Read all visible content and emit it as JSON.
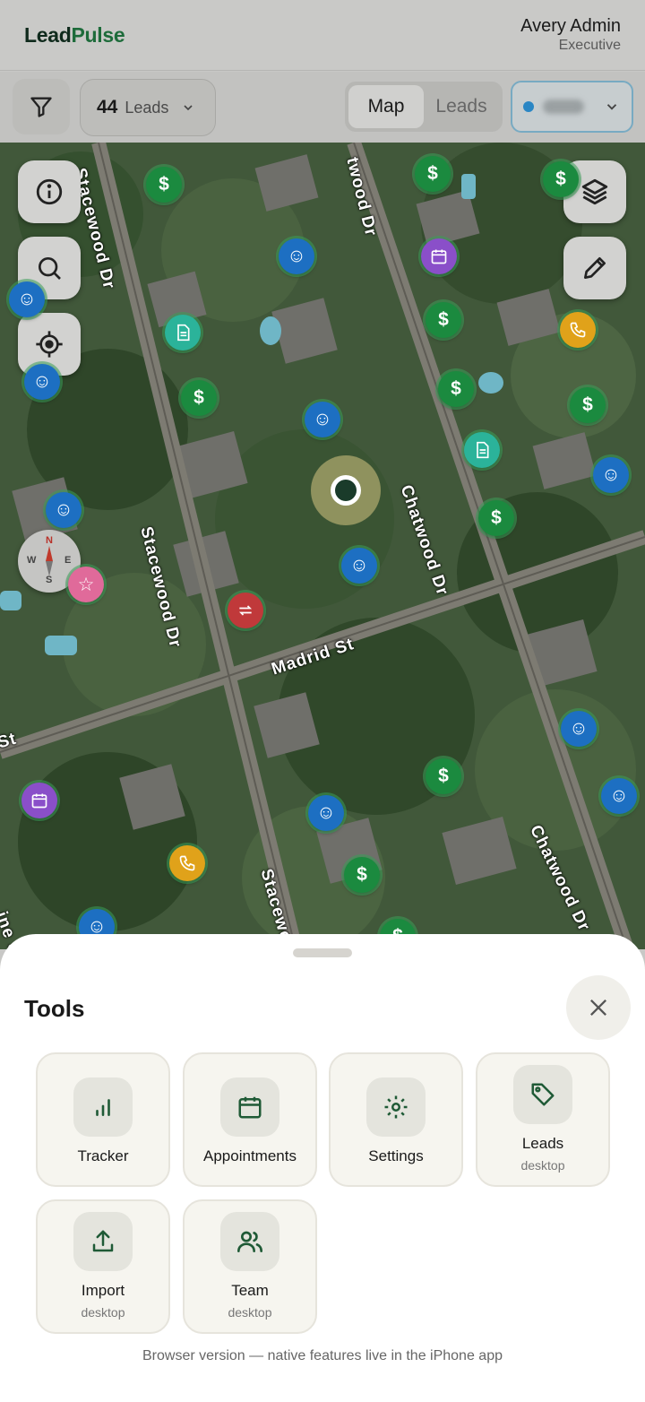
{
  "header": {
    "brand_part1": "Lead",
    "brand_part2": "Pulse",
    "user_name": "Avery Admin",
    "user_role": "Executive"
  },
  "toolbar": {
    "lead_count": "44",
    "lead_label": "Leads",
    "view_options": [
      "Map",
      "Leads"
    ],
    "active_view": "Map",
    "team_status_color": "#2a86c4"
  },
  "map": {
    "streets": [
      "Stacewood Dr",
      "twood Dr",
      "Stacewood Dr",
      "Chatwood Dr",
      "Madrid St",
      "Chatwood Dr",
      "Stacewoo",
      "St",
      "ine S"
    ]
  },
  "sheet": {
    "title": "Tools",
    "tools": [
      {
        "label": "Tracker",
        "icon": "bar-chart-icon"
      },
      {
        "label": "Appointments",
        "icon": "calendar-icon"
      },
      {
        "label": "Settings",
        "icon": "gear-icon"
      },
      {
        "label": "Leads",
        "sub": "desktop",
        "icon": "tag-icon"
      },
      {
        "label": "Import",
        "sub": "desktop",
        "icon": "upload-icon"
      },
      {
        "label": "Team",
        "sub": "desktop",
        "icon": "users-icon"
      }
    ],
    "footnote": "Browser version — native features live in the iPhone app"
  },
  "colors": {
    "brand_dark": "#0f2a1c",
    "brand_green": "#1d6b3a",
    "icon_green": "#1f5a36"
  }
}
